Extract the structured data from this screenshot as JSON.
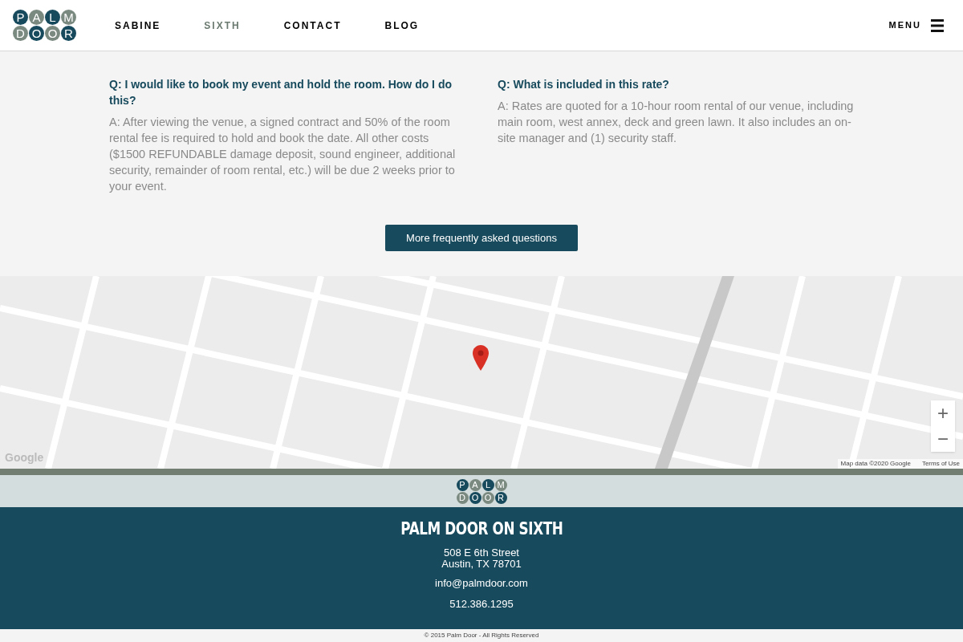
{
  "header": {
    "logo": {
      "rows": [
        [
          "P",
          "A",
          "L",
          "M"
        ],
        [
          "D",
          "O",
          "O",
          "R"
        ]
      ]
    },
    "nav": [
      {
        "label": "SABINE",
        "selected": false
      },
      {
        "label": "SIXTH",
        "selected": true
      },
      {
        "label": "CONTACT",
        "selected": false
      },
      {
        "label": "BLOG",
        "selected": false
      }
    ],
    "menu_label": "MENU"
  },
  "faq": [
    {
      "question": "Q: I would like to book my event and hold the room. How do I do this?",
      "answer": "A: After viewing the venue, a signed contract and 50% of the room rental fee is required to hold and book the date. All other costs ($1500 REFUNDABLE damage deposit, sound engineer, additional security, remainder of room rental, etc.) will be due 2 weeks prior to your event."
    },
    {
      "question": "Q: What is included in this rate?",
      "answer": "A: Rates are quoted for a 10-hour room rental of our venue, including main room, west annex, deck and green lawn. It also includes an on-site manager and (1) security staff."
    }
  ],
  "more_button": "More frequently asked questions",
  "map": {
    "zoom_in": "+",
    "zoom_out": "−",
    "google": "Google",
    "attribution": "Map data ©2020 Google",
    "terms": "Terms of Use"
  },
  "footer": {
    "logo": {
      "rows": [
        [
          "P",
          "A",
          "L",
          "M"
        ],
        [
          "D",
          "O",
          "O",
          "R"
        ]
      ]
    },
    "title": "PALM DOOR ON SIXTH",
    "address": [
      "508 E 6th Street",
      "Austin, TX 78701"
    ],
    "email": "info@palmdoor.com",
    "phone": "512.386.1295",
    "copyright": "© 2015 Palm Door - All Rights Reserved"
  }
}
